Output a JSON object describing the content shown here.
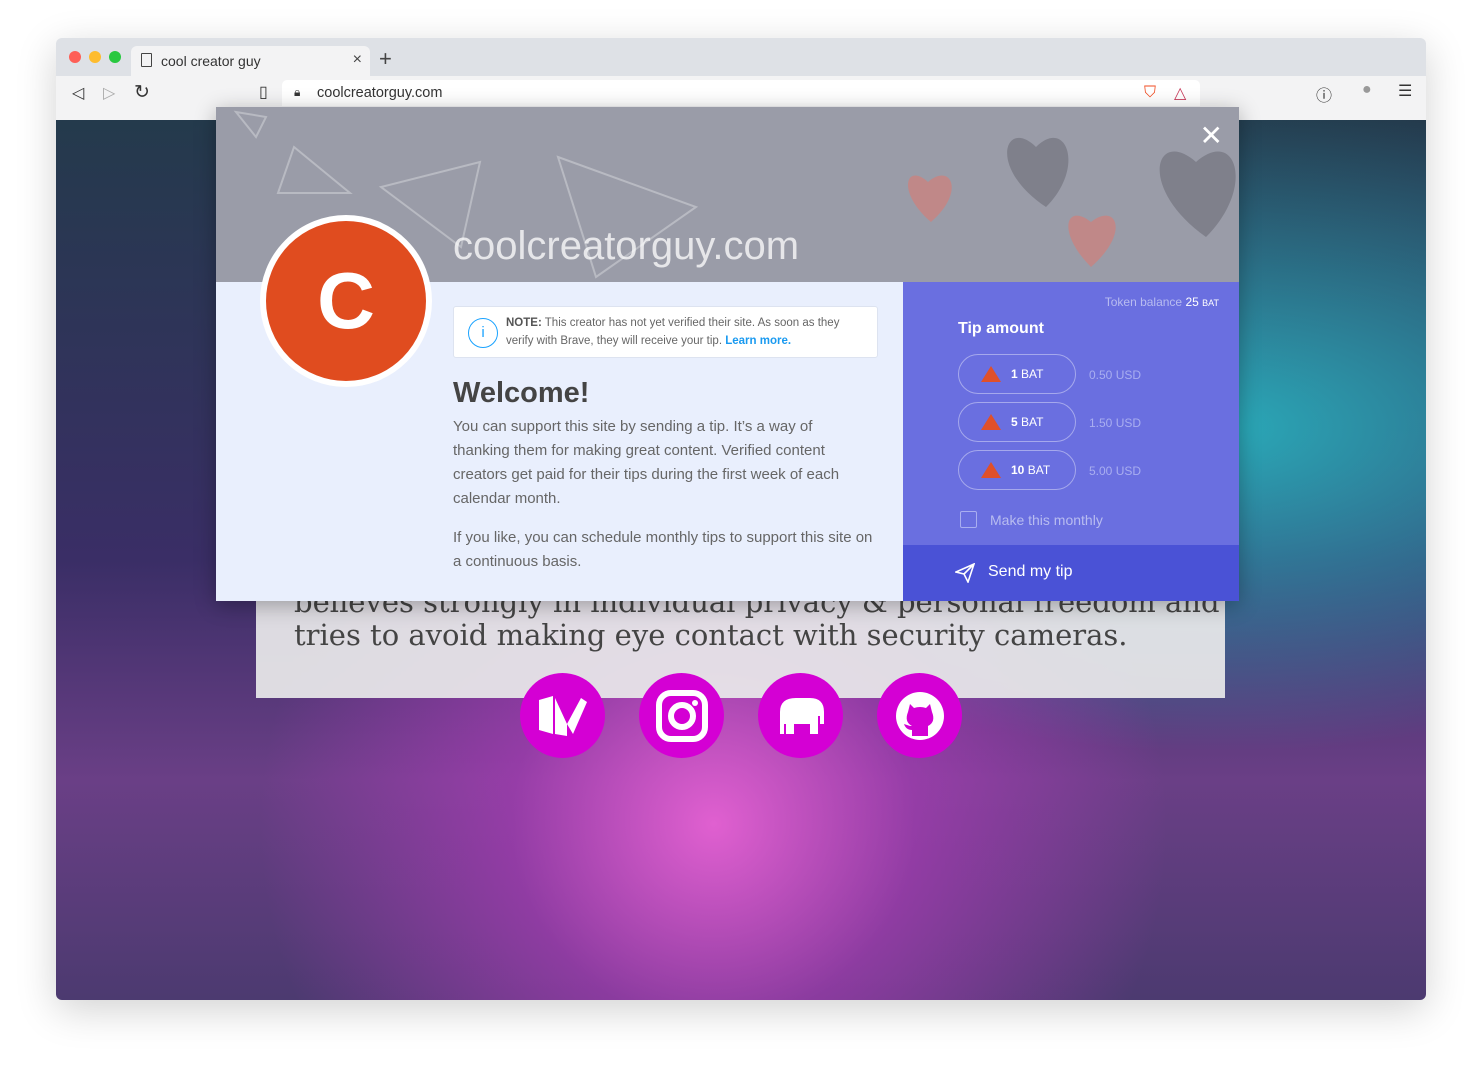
{
  "browser": {
    "tab_title": "cool creator guy",
    "url": "coolcreatorguy.com"
  },
  "page": {
    "bio_line1": "believes strongly in individual privacy & personal freedom and",
    "bio_line2": "tries to avoid making eye contact with security cameras.",
    "social": [
      "medium-icon",
      "instagram-icon",
      "mastodon-icon",
      "github-icon"
    ]
  },
  "modal": {
    "site_name": "coolcreatorguy.com",
    "avatar_letter": "C",
    "note_label": "NOTE:",
    "note_text": "This creator has not yet verified their site. As soon as they verify with Brave, they will receive your tip.",
    "learn_more": "Learn more.",
    "welcome": "Welcome!",
    "para1": "You can support this site by sending a tip. It’s a way of thanking them for making great content. Verified content creators get paid for their tips during the first week of each calendar month.",
    "para2": "If you like, you can schedule monthly tips to support this site on a continuous basis.",
    "balance_label": "Token balance",
    "balance_value": "25",
    "balance_unit": "BAT",
    "tip_title": "Tip amount",
    "amounts": [
      {
        "n": "1",
        "unit": "BAT",
        "usd": "0.50 USD"
      },
      {
        "n": "5",
        "unit": "BAT",
        "usd": "1.50 USD"
      },
      {
        "n": "10",
        "unit": "BAT",
        "usd": "5.00 USD"
      }
    ],
    "monthly_label": "Make this monthly",
    "monthly_checked": false,
    "send_label": "Send my tip"
  },
  "colors": {
    "accent": "#6a6fe0",
    "send": "#4a52d6",
    "avatar": "#e04c1f",
    "social": "#d400d4"
  }
}
